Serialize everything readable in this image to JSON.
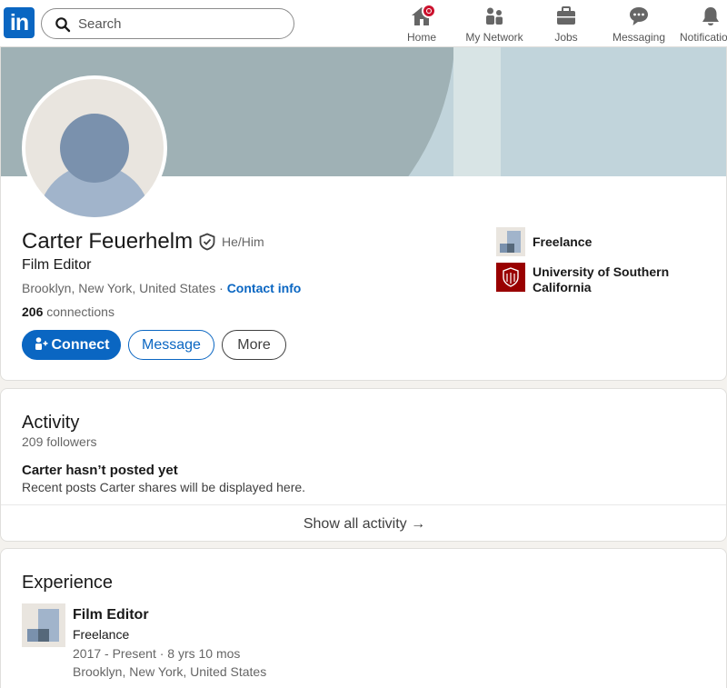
{
  "nav": {
    "logo_text": "in",
    "search_placeholder": "Search",
    "items": [
      {
        "label": "Home",
        "icon": "home-icon"
      },
      {
        "label": "My Network",
        "icon": "network-icon"
      },
      {
        "label": "Jobs",
        "icon": "briefcase-icon"
      },
      {
        "label": "Messaging",
        "icon": "messaging-icon"
      },
      {
        "label": "Notifications",
        "icon": "bell-icon"
      }
    ]
  },
  "profile": {
    "name": "Carter Feuerhelm",
    "pronouns": "He/Him",
    "headline": "Film Editor",
    "location": "Brooklyn, New York, United States",
    "location_sep": " · ",
    "contact_info": "Contact info",
    "connections_count": "206",
    "connections_label": " connections",
    "buttons": {
      "connect": "Connect",
      "message": "Message",
      "more": "More"
    },
    "current_company": "Freelance",
    "education": "University of Southern California"
  },
  "activity": {
    "title": "Activity",
    "followers": "209 followers",
    "empty_title": "Carter hasn’t posted yet",
    "empty_sub": "Recent posts Carter shares will be displayed here.",
    "show_all": "Show all activity →"
  },
  "experience": {
    "title": "Experience",
    "items": [
      {
        "title": "Film Editor",
        "company": "Freelance",
        "dates": "2017 - Present · 8 yrs 10 mos",
        "location": "Brooklyn, New York, United States"
      }
    ]
  },
  "colors": {
    "brand": "#0a66c2",
    "badge": "#cb112d",
    "usc": "#990000"
  }
}
